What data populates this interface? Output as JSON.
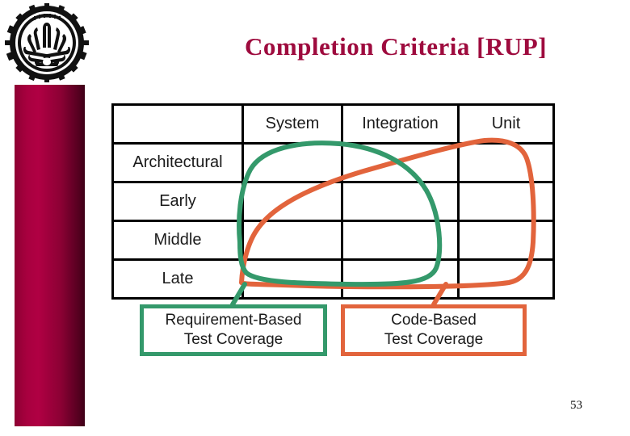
{
  "slide": {
    "title": "Completion Criteria [RUP]",
    "page_number": "53",
    "title_color": "#9e0b3e",
    "sidebar_color_start": "#a8003f",
    "sidebar_color_end": "#3e0017",
    "logo_name": "sharif-university-gear-logo"
  },
  "matrix": {
    "corner_label": "",
    "column_headers": [
      "",
      "System",
      "Integration",
      "Unit"
    ],
    "row_labels": [
      "Architectural",
      "Early",
      "Middle",
      "Late"
    ],
    "cells": [
      [
        "Architectural",
        "",
        "",
        ""
      ],
      [
        "Early",
        "",
        "",
        ""
      ],
      [
        "Middle",
        "",
        "",
        ""
      ],
      [
        "Late",
        "",
        "",
        ""
      ]
    ]
  },
  "annotations": {
    "green": {
      "label_line1": "Requirement-Based",
      "label_line2": "Test Coverage",
      "color": "#34996b",
      "region": "closed-curve spanning System and Integration columns across Architectural through Late rows"
    },
    "orange": {
      "label_line1": "Code-Based",
      "label_line2": "Test Coverage",
      "color": "#e2643c",
      "region": "closed-curve spanning System through Unit columns, peaking at Unit/Architectural"
    }
  }
}
